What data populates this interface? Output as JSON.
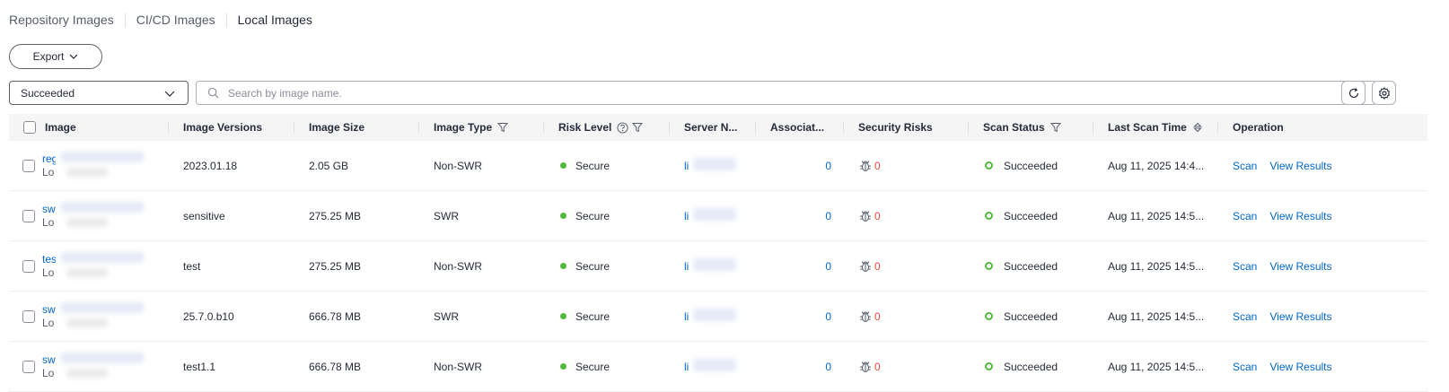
{
  "tabs": [
    {
      "label": "Repository Images",
      "active": false
    },
    {
      "label": "CI/CD Images",
      "active": false
    },
    {
      "label": "Local Images",
      "active": true
    }
  ],
  "toolbar": {
    "export_label": "Export",
    "filter_value": "Succeeded",
    "search_placeholder": "Search by image name."
  },
  "columns": {
    "image": "Image",
    "versions": "Image Versions",
    "size": "Image Size",
    "type": "Image Type",
    "risk": "Risk Level",
    "server": "Server N...",
    "assoc": "Associat...",
    "security": "Security Risks",
    "scan_status": "Scan Status",
    "last_scan": "Last Scan Time",
    "operation": "Operation"
  },
  "rows": [
    {
      "name": "reg",
      "sub": "Lo",
      "version": "2023.01.18",
      "size": "2.05 GB",
      "type": "Non-SWR",
      "risk": "Secure",
      "server": "li",
      "assoc": "0",
      "sec_count": "0",
      "status": "Succeeded",
      "time": "Aug 11, 2025 14:4...",
      "op_scan": "Scan",
      "op_view": "View Results"
    },
    {
      "name": "sw",
      "sub": "Lo",
      "version": "sensitive",
      "size": "275.25 MB",
      "type": "SWR",
      "risk": "Secure",
      "server": "li",
      "assoc": "0",
      "sec_count": "0",
      "status": "Succeeded",
      "time": "Aug 11, 2025 14:5...",
      "op_scan": "Scan",
      "op_view": "View Results"
    },
    {
      "name": "tes",
      "sub": "Lo",
      "version": "test",
      "size": "275.25 MB",
      "type": "Non-SWR",
      "risk": "Secure",
      "server": "li",
      "assoc": "0",
      "sec_count": "0",
      "status": "Succeeded",
      "time": "Aug 11, 2025 14:5...",
      "op_scan": "Scan",
      "op_view": "View Results"
    },
    {
      "name": "sw",
      "sub": "Lo",
      "version": "25.7.0.b10",
      "size": "666.78 MB",
      "type": "SWR",
      "risk": "Secure",
      "server": "li",
      "assoc": "0",
      "sec_count": "0",
      "status": "Succeeded",
      "time": "Aug 11, 2025 14:5...",
      "op_scan": "Scan",
      "op_view": "View Results"
    },
    {
      "name": "sw",
      "sub": "Lo",
      "version": "test1.1",
      "size": "666.78 MB",
      "type": "Non-SWR",
      "risk": "Secure",
      "server": "li",
      "assoc": "0",
      "sec_count": "0",
      "status": "Succeeded",
      "time": "Aug 11, 2025 14:5...",
      "op_scan": "Scan",
      "op_view": "View Results"
    }
  ],
  "colors": {
    "link": "#0066cc",
    "secure": "#50b83c",
    "risk": "#e54545"
  }
}
